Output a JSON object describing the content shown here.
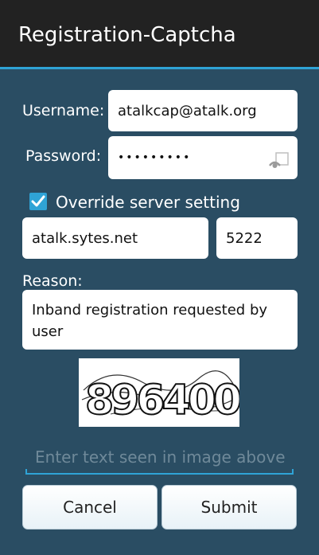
{
  "app": {
    "title": "Registration-Captcha"
  },
  "colors": {
    "background": "#2a4d63",
    "titlebar": "#222222",
    "accent": "#2fa3d6"
  },
  "form": {
    "username_label": "Username:",
    "username_value": "atalkcap@atalk.org",
    "password_label": "Password:",
    "password_masked": "•••••••••",
    "override": {
      "label": "Override server setting",
      "checked": true
    },
    "server_host": "atalk.sytes.net",
    "server_port": "5222",
    "reason_label": "Reason:",
    "reason_value": "Inband registration requested by user",
    "captcha_text": "896400",
    "captcha_input_placeholder": "Enter text seen in image above"
  },
  "buttons": {
    "cancel": "Cancel",
    "submit": "Submit"
  },
  "icons": {
    "password_toggle": "eye-icon",
    "checkbox": "checkbox-checked-icon"
  }
}
